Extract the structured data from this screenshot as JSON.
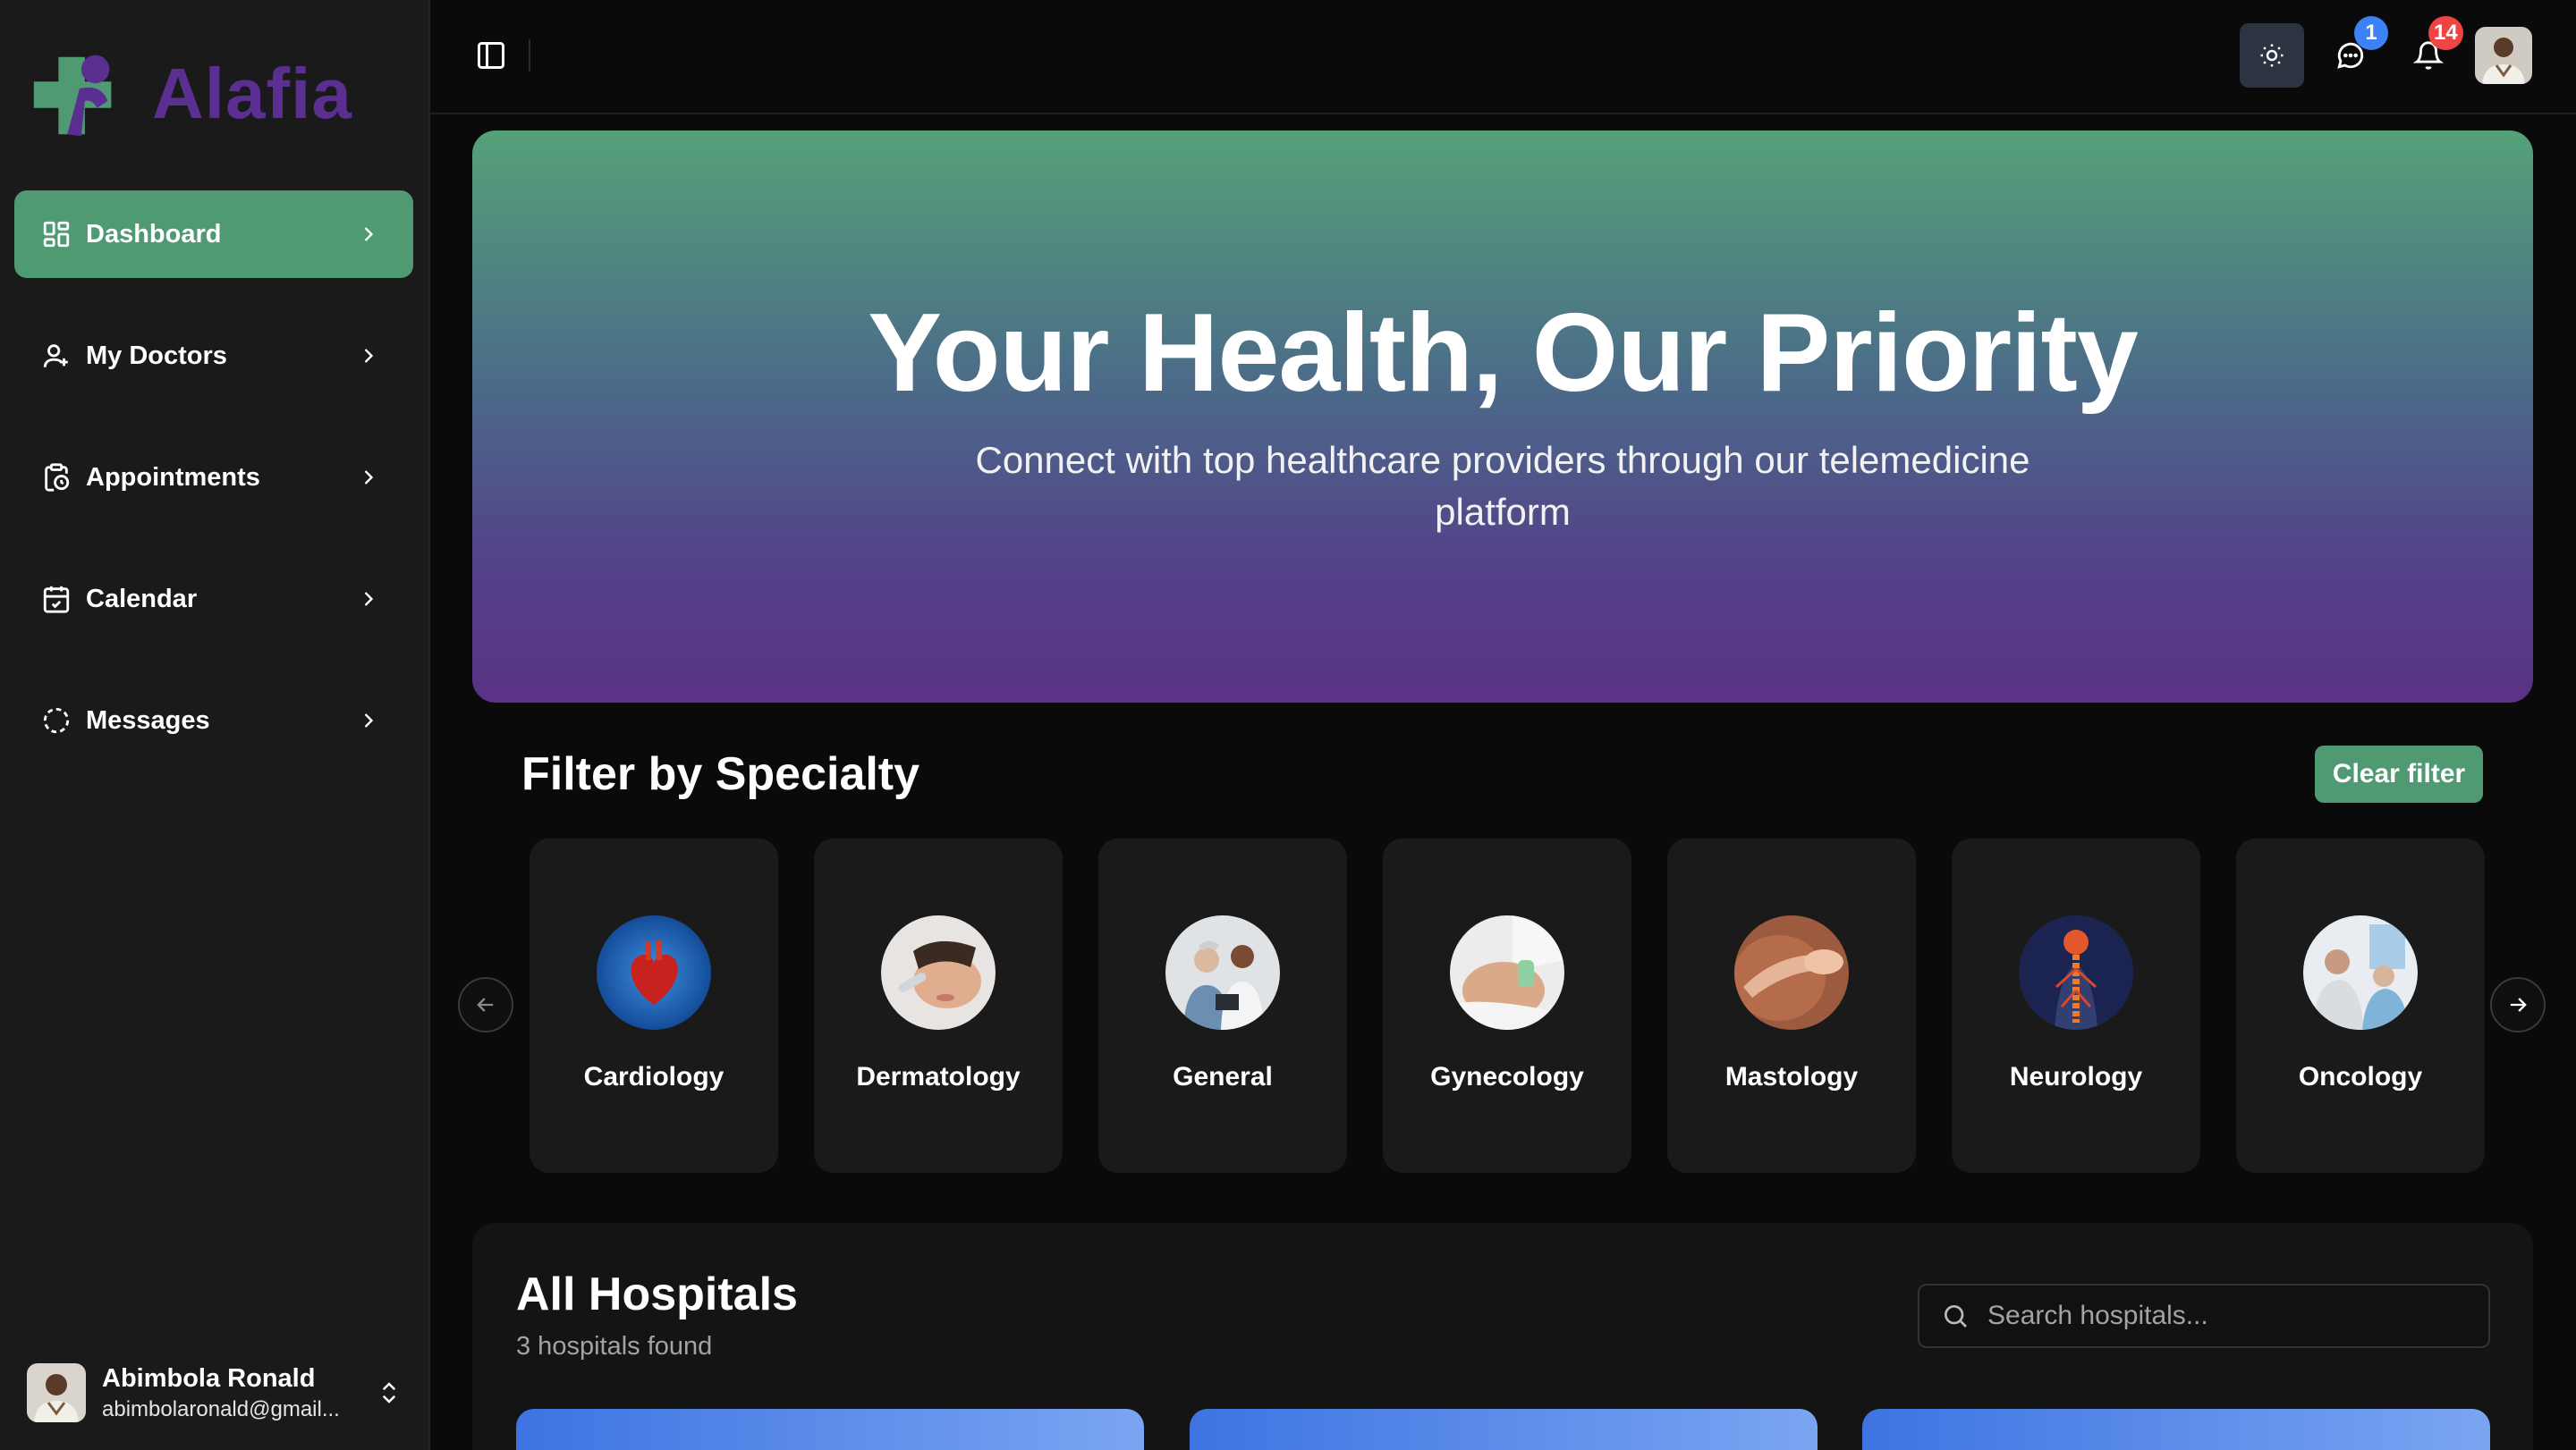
{
  "app": {
    "name": "Alafia"
  },
  "sidebar": {
    "items": [
      {
        "label": "Dashboard",
        "icon": "dashboard-icon",
        "active": true
      },
      {
        "label": "My Doctors",
        "icon": "user-plus-icon",
        "active": false
      },
      {
        "label": "Appointments",
        "icon": "clipboard-clock-icon",
        "active": false
      },
      {
        "label": "Calendar",
        "icon": "calendar-check-icon",
        "active": false
      },
      {
        "label": "Messages",
        "icon": "dashed-circle-icon",
        "active": false
      }
    ],
    "user": {
      "name": "Abimbola Ronald",
      "email": "abimbolaronald@gmail..."
    }
  },
  "topbar": {
    "messages_badge": "1",
    "notifications_badge": "14"
  },
  "hero": {
    "title": "Your Health, Our Priority",
    "subtitle": "Connect with top healthcare providers through our telemedicine platform"
  },
  "filter": {
    "title": "Filter by Specialty",
    "clear_label": "Clear filter",
    "specialties": [
      {
        "label": "Cardiology"
      },
      {
        "label": "Dermatology"
      },
      {
        "label": "General"
      },
      {
        "label": "Gynecology"
      },
      {
        "label": "Mastology"
      },
      {
        "label": "Neurology"
      },
      {
        "label": "Oncology"
      }
    ]
  },
  "hospitals": {
    "title": "All Hospitals",
    "count_text": "3 hospitals found",
    "search_placeholder": "Search hospitals..."
  },
  "colors": {
    "accent_green": "#4f9a73",
    "brand_purple": "#5b2e91",
    "badge_blue": "#3b82f6",
    "badge_red": "#ef4444"
  }
}
